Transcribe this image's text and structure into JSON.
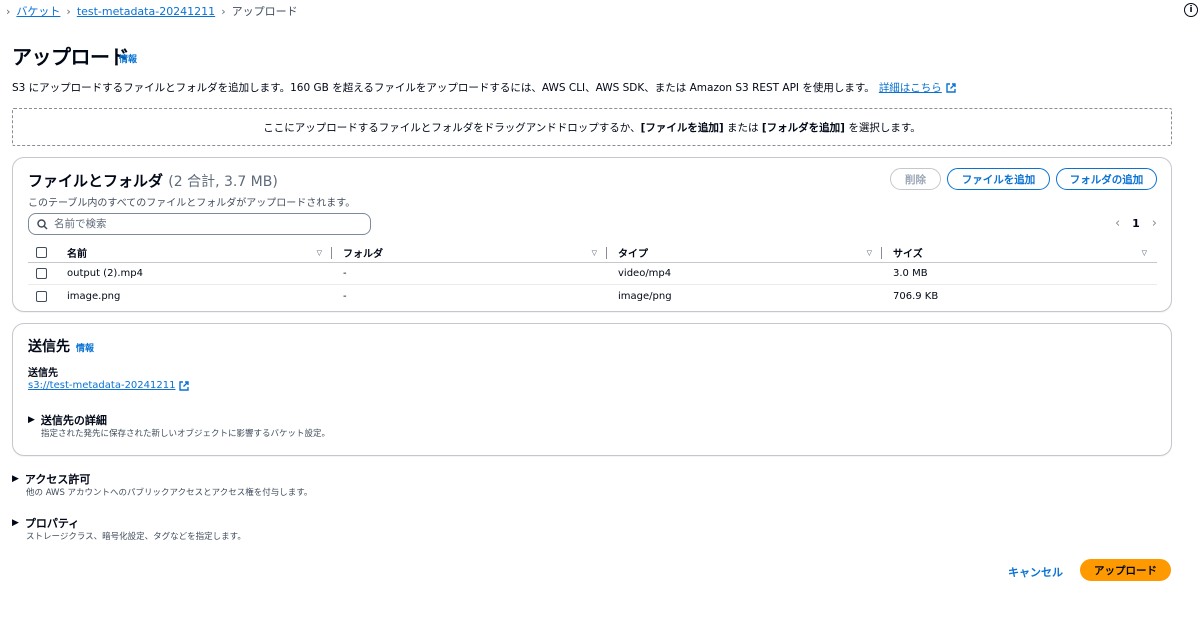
{
  "breadcrumb": {
    "items": [
      "バケット",
      "test-metadata-20241211",
      "アップロード"
    ]
  },
  "header": {
    "title": "アップロード",
    "info": "情報",
    "description": "S3 にアップロードするファイルとフォルダを追加します。160 GB を超えるファイルをアップロードするには、AWS CLI、AWS SDK、または Amazon S3 REST API を使用します。",
    "details_link": "詳細はこちら"
  },
  "dropzone": {
    "text_1": "ここにアップロードするファイルとフォルダをドラッグアンドドロップするか、",
    "text_bold_1": "[ファイルを追加]",
    "text_2": " または ",
    "text_bold_2": "[フォルダを追加]",
    "text_3": " を選択します。"
  },
  "files_panel": {
    "title": "ファイルとフォルダ",
    "count": "(2 合計, 3.7 MB)",
    "description": "このテーブル内のすべてのファイルとフォルダがアップロードされます。",
    "delete_button": "削除",
    "add_files_button": "ファイルを追加",
    "add_folder_button": "フォルダの追加",
    "search_placeholder": "名前で検索",
    "page": "1",
    "columns": [
      "名前",
      "フォルダ",
      "タイプ",
      "サイズ"
    ],
    "rows": [
      {
        "name": "output (2).mp4",
        "folder": "-",
        "type": "video/mp4",
        "size": "3.0 MB"
      },
      {
        "name": "image.png",
        "folder": "-",
        "type": "image/png",
        "size": "706.9 KB"
      }
    ]
  },
  "destination_panel": {
    "title": "送信先",
    "info": "情報",
    "label": "送信先",
    "link": "s3://test-metadata-20241211",
    "details_title": "送信先の詳細",
    "details_desc": "指定された発先に保存された新しいオブジェクトに影響するバケット設定。"
  },
  "permissions": {
    "title": "アクセス許可",
    "desc": "他の AWS アカウントへのパブリックアクセスとアクセス権を付与します。"
  },
  "properties": {
    "title": "プロパティ",
    "desc": "ストレージクラス、暗号化設定、タグなどを指定します。"
  },
  "footer": {
    "cancel": "キャンセル",
    "upload": "アップロード"
  },
  "colors": {
    "link": "#0972d3",
    "primary": "#ff9900",
    "text": "#000716"
  }
}
